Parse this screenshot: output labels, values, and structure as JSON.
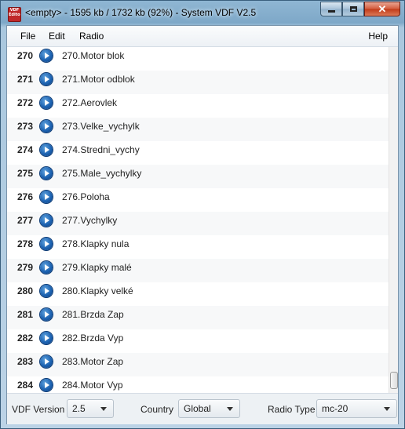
{
  "window": {
    "title": "<empty> - 1595 kb / 1732 kb (92%) - System VDF V2.5",
    "logo_text": [
      "VDF",
      "Editor"
    ]
  },
  "menu": {
    "file": "File",
    "edit": "Edit",
    "radio": "Radio",
    "help": "Help"
  },
  "list": {
    "rows": [
      {
        "num": "270",
        "label": "270.Motor blok"
      },
      {
        "num": "271",
        "label": "271.Motor odblok"
      },
      {
        "num": "272",
        "label": "272.Aerovlek"
      },
      {
        "num": "273",
        "label": "273.Velke_vychylk"
      },
      {
        "num": "274",
        "label": "274.Stredni_vychy"
      },
      {
        "num": "275",
        "label": "275.Male_vychylky"
      },
      {
        "num": "276",
        "label": "276.Poloha"
      },
      {
        "num": "277",
        "label": "277.Vychylky"
      },
      {
        "num": "278",
        "label": "278.Klapky nula"
      },
      {
        "num": "279",
        "label": "279.Klapky malé"
      },
      {
        "num": "280",
        "label": "280.Klapky velké"
      },
      {
        "num": "281",
        "label": "281.Brzda Zap"
      },
      {
        "num": "282",
        "label": "282.Brzda Vyp"
      },
      {
        "num": "283",
        "label": "283.Motor Zap"
      },
      {
        "num": "284",
        "label": "284.Motor Vyp"
      }
    ]
  },
  "footer": {
    "vdf_version_label": "VDF Version",
    "vdf_version_value": "2.5",
    "country_label": "Country",
    "country_value": "Global",
    "radio_type_label": "Radio Type",
    "radio_type_value": "mc-20"
  },
  "colors": {
    "title_bar": "#7ea8c8",
    "close_button": "#c13a18",
    "play_button": "#1d63b2"
  }
}
